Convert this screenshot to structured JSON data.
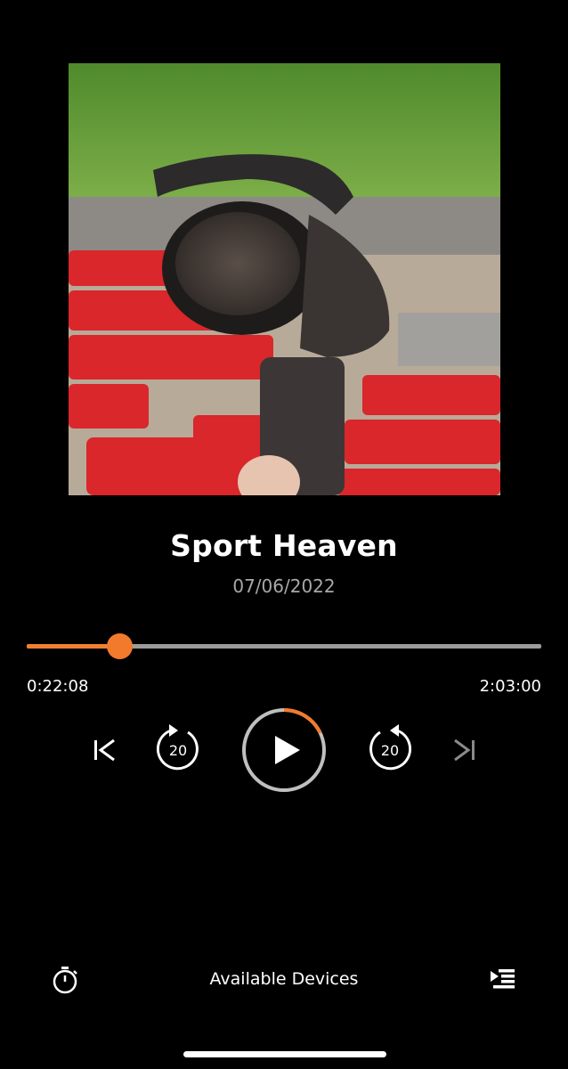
{
  "episode": {
    "title": "Sport Heaven",
    "date": "07/06/2022"
  },
  "playback": {
    "elapsed": "0:22:08",
    "duration": "2:03:00",
    "progress_fraction": 0.18,
    "play_ring_progress_fraction": 0.18,
    "skip_back_seconds": "20",
    "skip_forward_seconds": "20",
    "state": "paused"
  },
  "footer": {
    "devices_label": "Available Devices"
  },
  "icons": {
    "previous": "skip-to-start-icon",
    "rewind": "rewind-20-icon",
    "play": "play-icon",
    "forward": "forward-20-icon",
    "next": "skip-to-end-icon",
    "sleep_timer": "stopwatch-icon",
    "queue": "queue-list-icon"
  },
  "colors": {
    "accent": "#f27a2d",
    "background": "#000000",
    "track": "#9c9c9c",
    "disabled": "#8a8a8a"
  }
}
